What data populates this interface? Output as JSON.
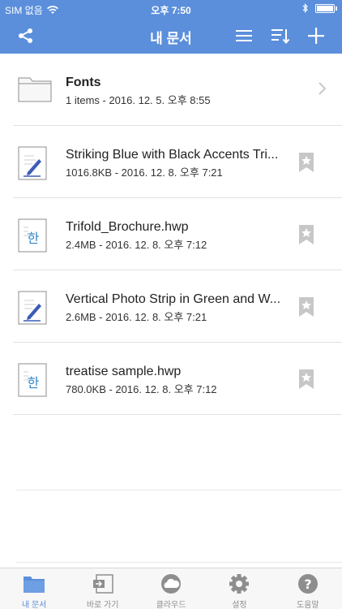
{
  "status_bar": {
    "carrier": "SIM 없음",
    "time": "오후 7:50"
  },
  "nav": {
    "title": "내 문서",
    "icons": [
      "share-icon",
      "menu-icon",
      "sort-icon",
      "add-icon"
    ]
  },
  "files": [
    {
      "type": "folder",
      "name": "Fonts",
      "meta": "1 items - 2016. 12. 5. 오후 8:55",
      "icon": "folder-icon"
    },
    {
      "type": "doc",
      "name": "Striking Blue with Black Accents Tri...",
      "meta": "1016.8KB - 2016. 12. 8. 오후 7:21",
      "icon": "document-pen-icon"
    },
    {
      "type": "hwp",
      "name": "Trifold_Brochure.hwp",
      "meta": "2.4MB - 2016. 12. 8. 오후 7:12",
      "icon": "hwp-file-icon"
    },
    {
      "type": "doc",
      "name": "Vertical Photo Strip in Green and W...",
      "meta": "2.6MB - 2016. 12. 8. 오후 7:21",
      "icon": "document-pen-icon"
    },
    {
      "type": "hwp",
      "name": "treatise sample.hwp",
      "meta": "780.0KB - 2016. 12. 8. 오후 7:12",
      "icon": "hwp-file-icon"
    }
  ],
  "tabs": [
    {
      "label": "내 문서",
      "icon": "folder-icon",
      "active": true
    },
    {
      "label": "바로 가기",
      "icon": "shortcut-icon",
      "active": false
    },
    {
      "label": "클라우드",
      "icon": "cloud-icon",
      "active": false
    },
    {
      "label": "설정",
      "icon": "gear-icon",
      "active": false
    },
    {
      "label": "도움말",
      "icon": "help-icon",
      "active": false
    }
  ],
  "colors": {
    "accent": "#5b8fdc",
    "tab_inactive": "#8e8e8e",
    "bookmark": "#c7c7c7"
  }
}
